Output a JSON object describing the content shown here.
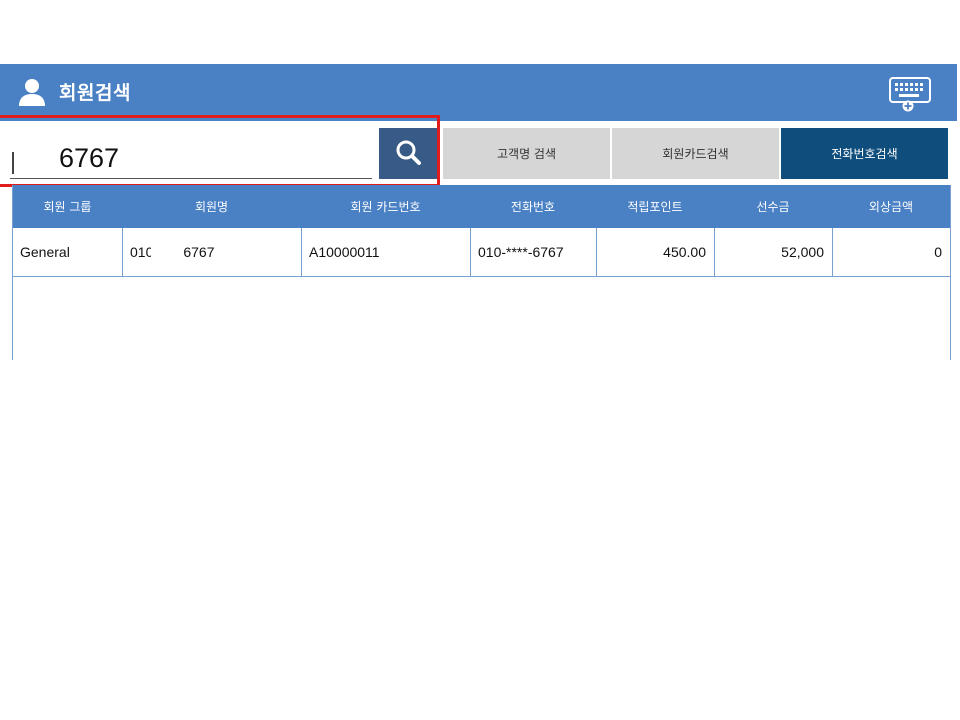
{
  "window": {
    "title": "회원검색",
    "title_icon": "user-icon",
    "keyboard_icon": "keyboard-icon"
  },
  "search": {
    "value": "6767",
    "button_icon": "search-icon"
  },
  "tabs": [
    {
      "label": "고객명 검색",
      "active": false
    },
    {
      "label": "회원카드검색",
      "active": false
    },
    {
      "label": "전화번호검색",
      "active": true
    }
  ],
  "table": {
    "columns": [
      "회원 그룹",
      "회원명",
      "회원 카드번호",
      "전화번호",
      "적립포인트",
      "선수금",
      "외상금액"
    ],
    "rows": [
      {
        "group": "General",
        "name_prefix": "010",
        "name_suffix": "6767",
        "card": "A10000011",
        "phone": "010-****-6767",
        "points": "450.00",
        "deposit": "52,000",
        "credit": "0"
      }
    ]
  },
  "colors": {
    "header_blue": "#4a80c4",
    "search_button": "#375b86",
    "active_tab": "#0f4d7c",
    "inactive_tab": "#d6d6d6",
    "highlight": "#e01c1c"
  }
}
